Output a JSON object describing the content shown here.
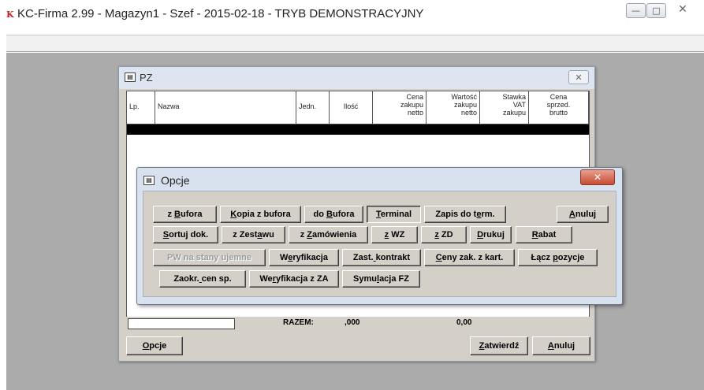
{
  "app": {
    "title": "KC-Firma 2.99 - Magazyn1 - Szef - 2015-02-18 - TRYB DEMONSTRACYJNY",
    "icon": "kc-app-icon"
  },
  "pz_window": {
    "title": "PZ",
    "columns": [
      "Lp.",
      "Nazwa",
      "Jedn.",
      "Ilość",
      "Cena zakupu netto",
      "Wartość zakupu netto",
      "Stawka VAT zakupu",
      "Cena sprzed. brutto"
    ],
    "col_lines": [
      [
        "Lp."
      ],
      [
        "Nazwa"
      ],
      [
        "Jedn."
      ],
      [
        "Ilość"
      ],
      [
        "Cena",
        "zakupu",
        "netto"
      ],
      [
        "Wartość",
        "zakupu",
        "netto"
      ],
      [
        "Stawka",
        "VAT",
        "zakupu"
      ],
      [
        "Cena",
        "sprzed.",
        "brutto"
      ]
    ],
    "razem_label": "RAZEM:",
    "razem_qty": ",000",
    "razem_value": "0,00",
    "buttons": {
      "opcje": "Opcje",
      "zatwierdz": "Zatwierdź",
      "anuluj": "Anuluj"
    }
  },
  "opcje_dialog": {
    "title": "Opcje",
    "buttons": [
      {
        "label": "z Bufora",
        "enabled": true
      },
      {
        "label": "Kopia z bufora",
        "enabled": true
      },
      {
        "label": "do Bufora",
        "enabled": true
      },
      {
        "label": "Terminal",
        "enabled": true,
        "pressed": true
      },
      {
        "label": "Zapis do term.",
        "enabled": true
      },
      {
        "label": "Anuluj",
        "enabled": true
      },
      {
        "label": "Sortuj dok.",
        "enabled": true
      },
      {
        "label": "z Zestawu",
        "enabled": true
      },
      {
        "label": "z Zamówienia",
        "enabled": true
      },
      {
        "label": "z WZ",
        "enabled": true
      },
      {
        "label": "z ZD",
        "enabled": true
      },
      {
        "label": "Drukuj",
        "enabled": true
      },
      {
        "label": "Rabat",
        "enabled": true
      },
      {
        "label": "PW na stany ujemne",
        "enabled": false
      },
      {
        "label": "Weryfikacja",
        "enabled": true
      },
      {
        "label": "Zast. kontrakt",
        "enabled": true
      },
      {
        "label": "Ceny zak. z kart.",
        "enabled": true
      },
      {
        "label": "Łącz pozycje",
        "enabled": true
      },
      {
        "label": "Zaokr. cen sp.",
        "enabled": true
      },
      {
        "label": "Weryfikacja z ZA",
        "enabled": true
      },
      {
        "label": "Symulacja FZ",
        "enabled": true
      }
    ]
  }
}
